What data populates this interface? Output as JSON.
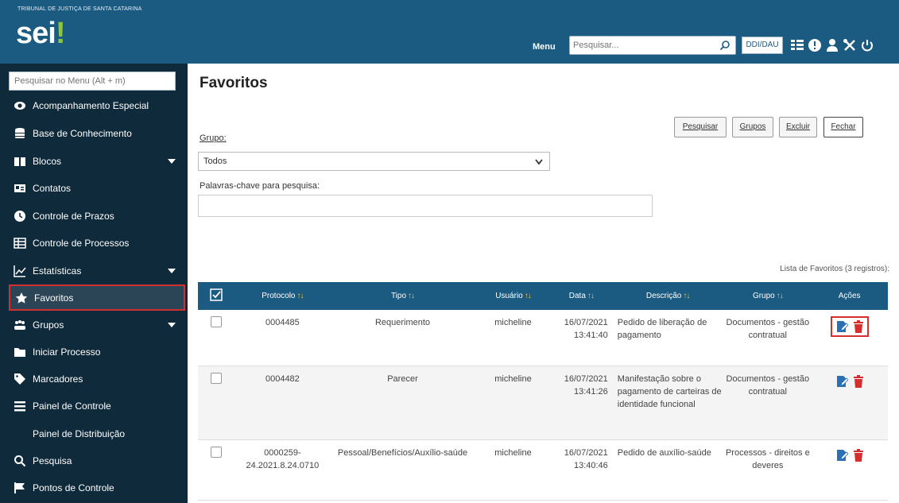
{
  "header": {
    "tribunal": "TRIBUNAL DE JUSTIÇA DE SANTA CATARINA",
    "logo": "sei",
    "menu_label": "Menu",
    "search_placeholder": "Pesquisar...",
    "unit_label": "DDI/DAU",
    "accent": "#1b5b82",
    "icons": [
      "grid-icon",
      "info-icon",
      "user-icon",
      "tools-icon",
      "power-icon"
    ]
  },
  "sidebar": {
    "search_placeholder": "Pesquisar no Menu (Alt + m)",
    "items": [
      {
        "label": "Acompanhamento Especial",
        "icon": "eye-icon"
      },
      {
        "label": "Base de Conhecimento",
        "icon": "database-icon"
      },
      {
        "label": "Blocos",
        "icon": "book-icon",
        "expandable": true
      },
      {
        "label": "Contatos",
        "icon": "contacts-icon"
      },
      {
        "label": "Controle de Prazos",
        "icon": "clock-icon"
      },
      {
        "label": "Controle de Processos",
        "icon": "list-icon"
      },
      {
        "label": "Estatísticas",
        "icon": "chart-icon",
        "expandable": true
      },
      {
        "label": "Favoritos",
        "icon": "star-icon",
        "active": true
      },
      {
        "label": "Grupos",
        "icon": "group-icon",
        "expandable": true
      },
      {
        "label": "Iniciar Processo",
        "icon": "folder-icon"
      },
      {
        "label": "Marcadores",
        "icon": "tag-icon"
      },
      {
        "label": "Painel de Controle",
        "icon": "menu-icon"
      },
      {
        "label": "Painel de Distribuição",
        "icon": ""
      },
      {
        "label": "Pesquisa",
        "icon": "magnifier-icon"
      },
      {
        "label": "Pontos de Controle",
        "icon": "flag-icon"
      }
    ]
  },
  "main": {
    "title": "Favoritos",
    "buttons": [
      "Pesquisar",
      "Grupos",
      "Excluir",
      "Fechar"
    ],
    "grupo_label": "Grupo:",
    "grupo_value": "Todos",
    "palavras_label": "Palavras-chave para pesquisa:",
    "lista_caption": "Lista de Favoritos (3 registros):",
    "table": {
      "headers": [
        "Protocolo",
        "Tipo",
        "Usuário",
        "Data",
        "Descrição",
        "Grupo",
        "Ações"
      ],
      "rows": [
        {
          "protocolo": "0004485",
          "tipo": "Requerimento",
          "usuario": "micheline",
          "data": "16/07/2021",
          "hora": "13:41:40",
          "descricao": "Pedido de liberação de pagamento",
          "grupo": "Documentos - gestão contratual"
        },
        {
          "protocolo": "0004482",
          "tipo": "Parecer",
          "usuario": "micheline",
          "data": "16/07/2021",
          "hora": "13:41:26",
          "descricao": "Manifestação sobre o pagamento de carteiras de identidade funcional",
          "grupo": "Documentos - gestão contratual"
        },
        {
          "protocolo": "0000259-24.2021.8.24.0710",
          "tipo": "Pessoal/Benefícios/Auxílio-saúde",
          "usuario": "micheline",
          "data": "16/07/2021",
          "hora": "13:40:46",
          "descricao": "Pedido de auxílio-saúde",
          "grupo": "Processos - direitos e deveres"
        }
      ]
    }
  }
}
